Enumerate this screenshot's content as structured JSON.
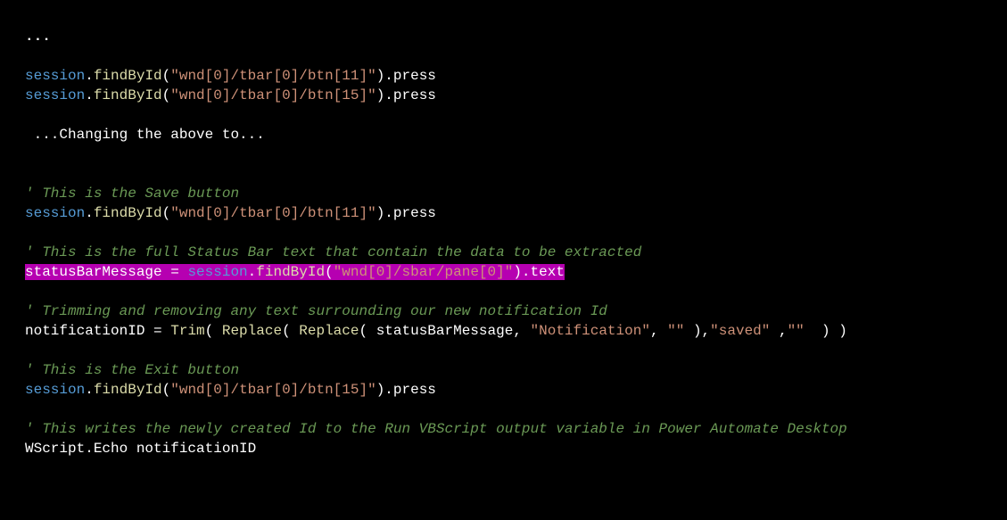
{
  "lines": {
    "dots1": "...",
    "l1_session": "session",
    "l1_find": "findById",
    "l1_str": "\"wnd[0]/tbar[0]/btn[11]\"",
    "l1_press": "press",
    "l2_session": "session",
    "l2_find": "findById",
    "l2_str": "\"wnd[0]/tbar[0]/btn[15]\"",
    "l2_press": "press",
    "changing": " ...Changing the above to...",
    "c1": "' This is the Save button",
    "l3_session": "session",
    "l3_find": "findById",
    "l3_str": "\"wnd[0]/tbar[0]/btn[11]\"",
    "l3_press": "press",
    "c2": "' This is the full Status Bar text that contain the data to be extracted",
    "hl_var": "statusBarMessage",
    "hl_eq": " = ",
    "hl_session": "session",
    "hl_find": "findById",
    "hl_str": "\"wnd[0]/sbar/pane[0]\"",
    "hl_text": "text",
    "c3": "' Trimming and removing any text surrounding our new notification Id",
    "nid_var": "notificationID = ",
    "nid_trim": "Trim",
    "nid_replace": "Replace",
    "nid_sbm": "statusBarMessage",
    "nid_notif": "\"Notification\"",
    "nid_empty": "\"\"",
    "nid_saved": "\"saved\"",
    "c4": "' This is the Exit button",
    "l4_session": "session",
    "l4_find": "findById",
    "l4_str": "\"wnd[0]/tbar[0]/btn[15]\"",
    "l4_press": "press",
    "c5": "' This writes the newly created Id to the Run VBScript output variable in Power Automate Desktop",
    "wscript": "WScript.Echo notificationID"
  }
}
